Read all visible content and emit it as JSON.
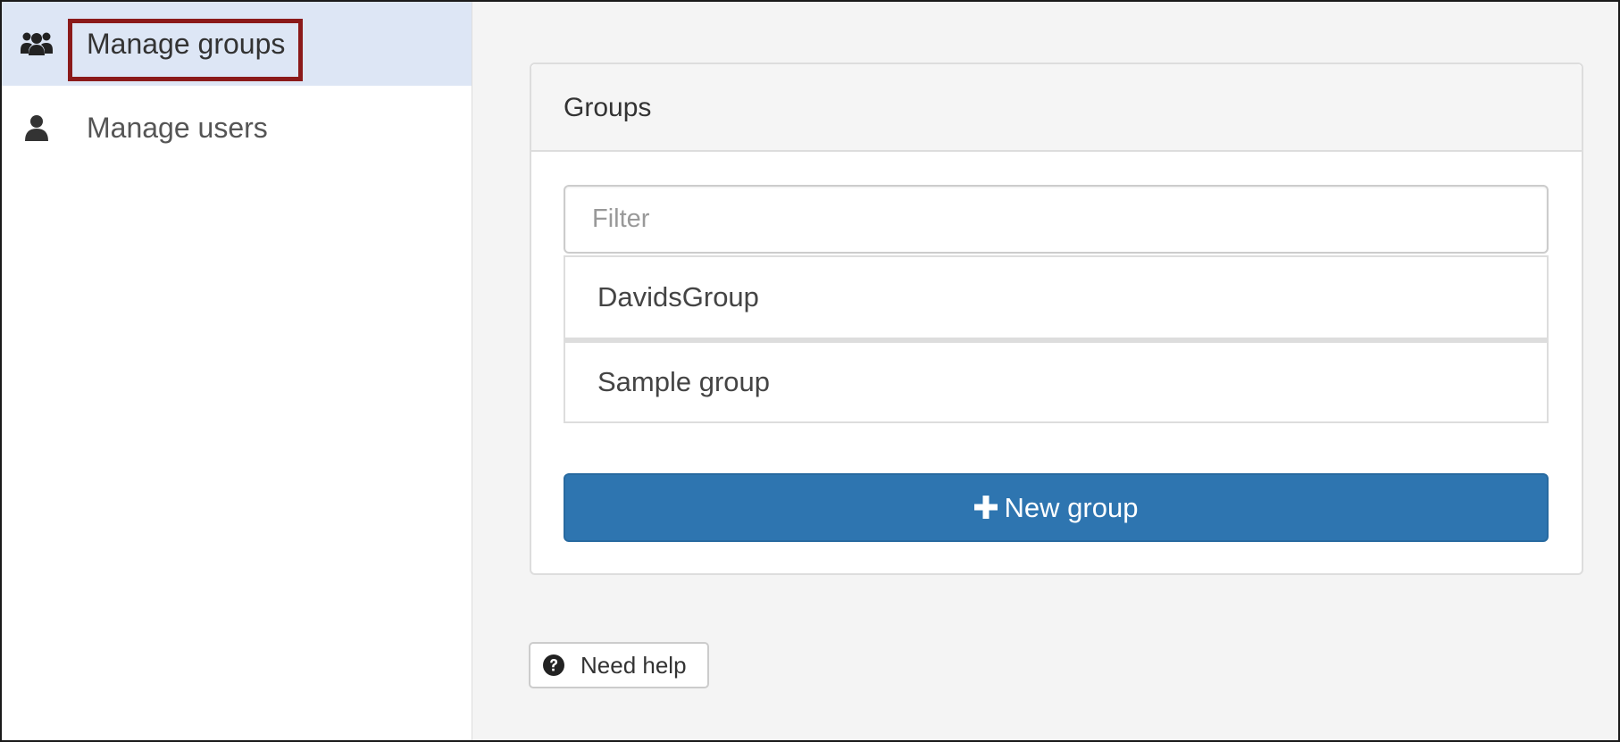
{
  "sidebar": {
    "items": [
      {
        "label": "Manage groups",
        "icon": "users-icon",
        "active": true
      },
      {
        "label": "Manage users",
        "icon": "user-icon",
        "active": false
      }
    ]
  },
  "panel": {
    "title": "Groups",
    "filter": {
      "placeholder": "Filter",
      "value": ""
    },
    "groups": [
      "DavidsGroup",
      "Sample group"
    ],
    "new_group_label": "New group",
    "new_group_icon": "plus-icon"
  },
  "help": {
    "label": "Need help",
    "icon": "question-circle-icon"
  },
  "colors": {
    "accent": "#2e75b0",
    "active_nav": "#dde6f5",
    "highlight_border": "#8b1a1a",
    "main_bg": "#f4f4f4"
  }
}
